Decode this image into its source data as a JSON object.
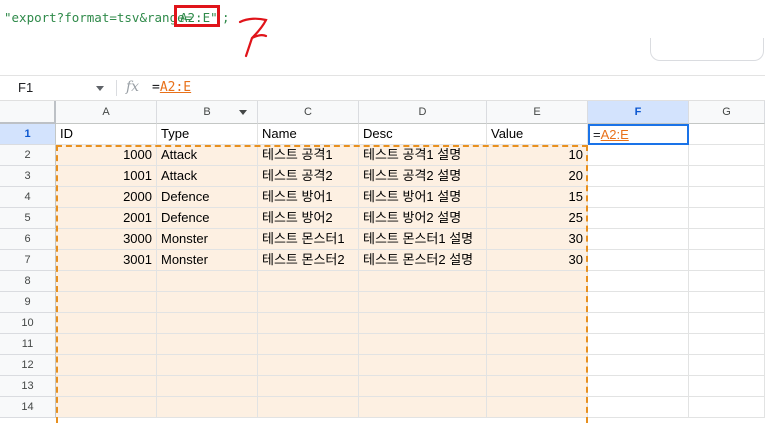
{
  "annotation": {
    "code_prefix": "\"export?format=tsv&range=",
    "code_highlight": "A2:E\"",
    "code_suffix": ";"
  },
  "formula_bar": {
    "cell_ref": "F1",
    "fx": "fx",
    "formula_eq": "=",
    "formula_ref": "A2:E"
  },
  "columns": [
    "A",
    "B",
    "C",
    "D",
    "E",
    "F",
    "G"
  ],
  "active_column": "F",
  "rows": [
    "1",
    "2",
    "3",
    "4",
    "5",
    "6",
    "7",
    "8",
    "9",
    "10",
    "11",
    "12",
    "13",
    "14"
  ],
  "active_row": "1",
  "headers": [
    "ID",
    "Type",
    "Name",
    "Desc",
    "Value"
  ],
  "data": [
    [
      "1000",
      "Attack",
      "테스트 공격1",
      "테스트 공격1 설명",
      "10"
    ],
    [
      "1001",
      "Attack",
      "테스트 공격2",
      "테스트 공격2 설명",
      "20"
    ],
    [
      "2000",
      "Defence",
      "테스트 방어1",
      "테스트 방어1 설명",
      "15"
    ],
    [
      "2001",
      "Defence",
      "테스트 방어2",
      "테스트 방어2 설명",
      "25"
    ],
    [
      "3000",
      "Monster",
      "테스트 몬스터1",
      "테스트 몬스터1 설명",
      "30"
    ],
    [
      "3001",
      "Monster",
      "테스트 몬스터2",
      "테스트 몬스터2 설명",
      "30"
    ]
  ],
  "selected_cell": {
    "ref": "F1",
    "eq": "=",
    "range": "A2:E"
  },
  "colors": {
    "range_tint": "#fdf0e2",
    "range_border": "#e8901f",
    "selection": "#1a73e8",
    "annotation_box": "#e0141a"
  }
}
